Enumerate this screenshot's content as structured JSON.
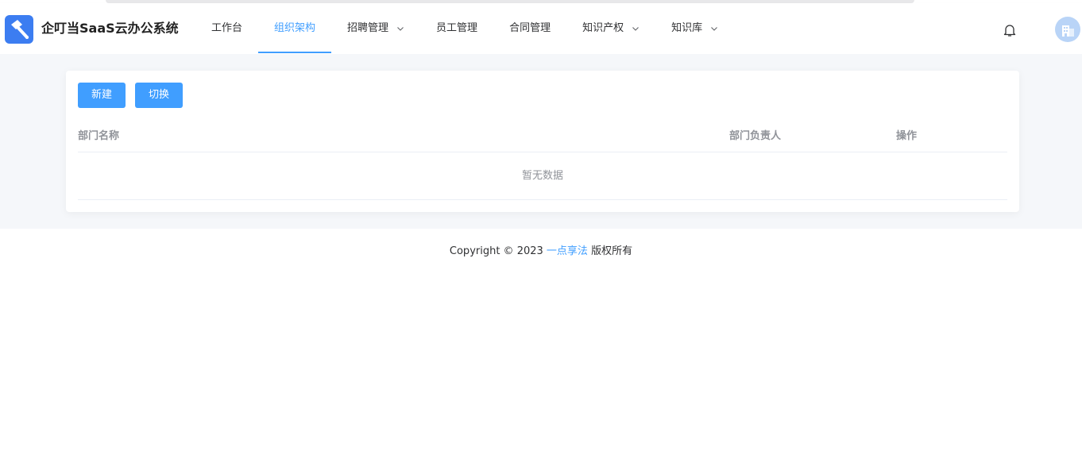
{
  "app": {
    "brand": "企叮当SaaS云办公系统"
  },
  "nav": {
    "items": [
      {
        "label": "工作台"
      },
      {
        "label": "组织架构"
      },
      {
        "label": "招聘管理"
      },
      {
        "label": "员工管理"
      },
      {
        "label": "合同管理"
      },
      {
        "label": "知识产权"
      },
      {
        "label": "知识库"
      }
    ],
    "active": "组织架构"
  },
  "toolbar": {
    "new_label": "新建",
    "switch_label": "切换"
  },
  "table": {
    "columns": [
      "部门名称",
      "部门负责人",
      "操作"
    ],
    "rows": [],
    "empty_text": "暂无数据"
  },
  "footer": {
    "prefix": "Copyright © 2023 ",
    "link": "一点享法",
    "suffix": " 版权所有"
  },
  "colors": {
    "accent": "#409eff",
    "logo": "#3c7df1",
    "page_bg": "#f5f7fa"
  },
  "icons": {
    "logo": "hammer-icon",
    "notifications": "bell-icon",
    "avatar": "building-icon",
    "dropdown": "chevron-down-icon"
  }
}
